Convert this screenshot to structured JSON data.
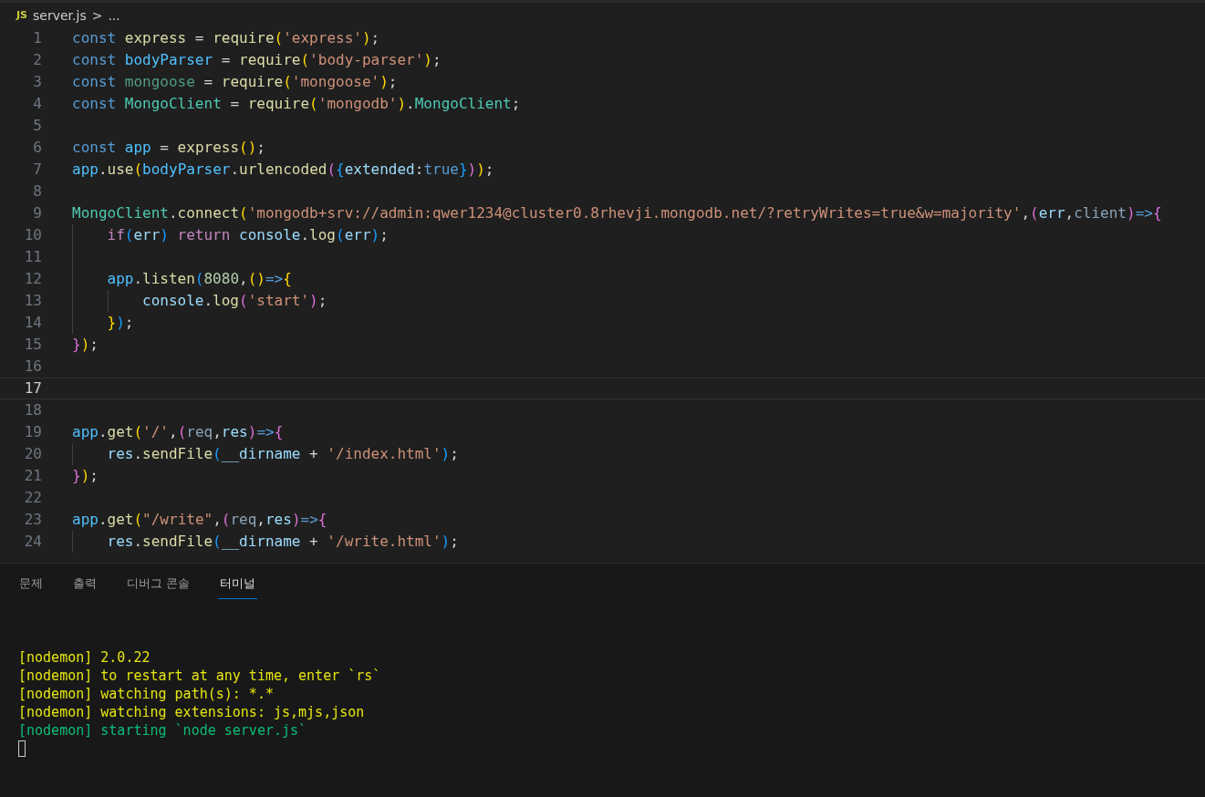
{
  "breadcrumb": {
    "file_badge": "JS",
    "file": "server.js",
    "separator": ">",
    "more": "..."
  },
  "editor": {
    "lines": [
      {
        "number": "1",
        "current": false,
        "kind": "top",
        "tokens": [
          {
            "text": "const ",
            "kind": "keyword"
          },
          {
            "text": "express",
            "kind": "func"
          },
          {
            "text": " = ",
            "kind": "plain"
          },
          {
            "text": "require",
            "kind": "func"
          },
          {
            "text": "(",
            "kind": "brace1"
          },
          {
            "text": "'express'",
            "kind": "string"
          },
          {
            "text": ")",
            "kind": "brace1"
          },
          {
            "text": ";",
            "kind": "plain"
          }
        ]
      },
      {
        "number": "2",
        "current": false,
        "kind": "top",
        "tokens": [
          {
            "text": "const ",
            "kind": "keyword"
          },
          {
            "text": "bodyParser",
            "kind": "constant"
          },
          {
            "text": " = ",
            "kind": "plain"
          },
          {
            "text": "require",
            "kind": "func"
          },
          {
            "text": "(",
            "kind": "brace1"
          },
          {
            "text": "'body-parser'",
            "kind": "string"
          },
          {
            "text": ")",
            "kind": "brace1"
          },
          {
            "text": ";",
            "kind": "plain"
          }
        ]
      },
      {
        "number": "3",
        "current": false,
        "kind": "top",
        "tokens": [
          {
            "text": "const ",
            "kind": "keyword"
          },
          {
            "text": "mongoose",
            "kind": "unused"
          },
          {
            "text": " = ",
            "kind": "plain"
          },
          {
            "text": "require",
            "kind": "func"
          },
          {
            "text": "(",
            "kind": "brace1"
          },
          {
            "text": "'mongoose'",
            "kind": "string"
          },
          {
            "text": ")",
            "kind": "brace1"
          },
          {
            "text": ";",
            "kind": "plain"
          }
        ]
      },
      {
        "number": "4",
        "current": false,
        "kind": "top",
        "tokens": [
          {
            "text": "const ",
            "kind": "keyword"
          },
          {
            "text": "MongoClient",
            "kind": "class"
          },
          {
            "text": " = ",
            "kind": "plain"
          },
          {
            "text": "require",
            "kind": "func"
          },
          {
            "text": "(",
            "kind": "brace1"
          },
          {
            "text": "'mongodb'",
            "kind": "string"
          },
          {
            "text": ")",
            "kind": "brace1"
          },
          {
            "text": ".",
            "kind": "plain"
          },
          {
            "text": "MongoClient",
            "kind": "class"
          },
          {
            "text": ";",
            "kind": "plain"
          }
        ]
      },
      {
        "number": "5",
        "current": false,
        "kind": "top"
      },
      {
        "number": "6",
        "current": false,
        "kind": "top",
        "tokens": [
          {
            "text": "const ",
            "kind": "keyword"
          },
          {
            "text": "app",
            "kind": "constant"
          },
          {
            "text": " = ",
            "kind": "plain"
          },
          {
            "text": "express",
            "kind": "func"
          },
          {
            "text": "()",
            "kind": "brace1"
          },
          {
            "text": ";",
            "kind": "plain"
          }
        ]
      },
      {
        "number": "7",
        "current": false,
        "kind": "top",
        "tokens": [
          {
            "text": "app",
            "kind": "constant"
          },
          {
            "text": ".",
            "kind": "plain"
          },
          {
            "text": "use",
            "kind": "func"
          },
          {
            "text": "(",
            "kind": "brace1"
          },
          {
            "text": "bodyParser",
            "kind": "constant"
          },
          {
            "text": ".",
            "kind": "plain"
          },
          {
            "text": "urlencoded",
            "kind": "func"
          },
          {
            "text": "(",
            "kind": "brace2"
          },
          {
            "text": "{",
            "kind": "brace3"
          },
          {
            "text": "extended",
            "kind": "variable"
          },
          {
            "text": ":",
            "kind": "plain"
          },
          {
            "text": "true",
            "kind": "keyword"
          },
          {
            "text": "}",
            "kind": "brace3"
          },
          {
            "text": ")",
            "kind": "brace2"
          },
          {
            "text": ")",
            "kind": "brace1"
          },
          {
            "text": ";",
            "kind": "plain"
          }
        ]
      },
      {
        "number": "8",
        "current": false,
        "kind": "top"
      },
      {
        "number": "9",
        "current": false,
        "kind": "top",
        "tokens": [
          {
            "text": "MongoClient",
            "kind": "class"
          },
          {
            "text": ".",
            "kind": "plain"
          },
          {
            "text": "connect",
            "kind": "func"
          },
          {
            "text": "(",
            "kind": "brace1"
          },
          {
            "text": "'mongodb+srv://admin:qwer1234@cluster0.8rhevji.mongodb.net/?retryWrites=true&w=majority'",
            "kind": "string"
          },
          {
            "text": ",",
            "kind": "plain"
          },
          {
            "text": "(",
            "kind": "brace2"
          },
          {
            "text": "err",
            "kind": "variable"
          },
          {
            "text": ",",
            "kind": "plain"
          },
          {
            "text": "client",
            "kind": "dim"
          },
          {
            "text": ")",
            "kind": "brace2"
          },
          {
            "text": "=>",
            "kind": "keyword"
          },
          {
            "text": "{",
            "kind": "brace2"
          }
        ]
      },
      {
        "number": "10",
        "current": false,
        "kind": "nested",
        "tokens": [
          {
            "text": "if",
            "kind": "control"
          },
          {
            "text": "(",
            "kind": "brace3"
          },
          {
            "text": "err",
            "kind": "variable"
          },
          {
            "text": ") ",
            "kind": "brace3"
          },
          {
            "text": "return ",
            "kind": "control"
          },
          {
            "text": "console",
            "kind": "variable"
          },
          {
            "text": ".",
            "kind": "plain"
          },
          {
            "text": "log",
            "kind": "func"
          },
          {
            "text": "(",
            "kind": "brace3"
          },
          {
            "text": "err",
            "kind": "variable"
          },
          {
            "text": ")",
            "kind": "brace3"
          },
          {
            "text": ";",
            "kind": "plain"
          }
        ]
      },
      {
        "number": "11",
        "current": false,
        "kind": "nested"
      },
      {
        "number": "12",
        "current": false,
        "kind": "nested",
        "tokens": [
          {
            "text": "app",
            "kind": "constant"
          },
          {
            "text": ".",
            "kind": "plain"
          },
          {
            "text": "listen",
            "kind": "func"
          },
          {
            "text": "(",
            "kind": "brace3"
          },
          {
            "text": "8080",
            "kind": "number"
          },
          {
            "text": ",",
            "kind": "plain"
          },
          {
            "text": "()",
            "kind": "brace1"
          },
          {
            "text": "=>",
            "kind": "keyword"
          },
          {
            "text": "{",
            "kind": "brace1"
          }
        ]
      },
      {
        "number": "13",
        "current": false,
        "kind": "deep",
        "tokens": [
          {
            "text": "console",
            "kind": "variable"
          },
          {
            "text": ".",
            "kind": "plain"
          },
          {
            "text": "log",
            "kind": "func"
          },
          {
            "text": "(",
            "kind": "brace2"
          },
          {
            "text": "'start'",
            "kind": "string"
          },
          {
            "text": ")",
            "kind": "brace2"
          },
          {
            "text": ";",
            "kind": "plain"
          }
        ]
      },
      {
        "number": "14",
        "current": false,
        "kind": "nested",
        "tokens": [
          {
            "text": "}",
            "kind": "brace1"
          },
          {
            "text": ")",
            "kind": "brace3"
          },
          {
            "text": ";",
            "kind": "plain"
          }
        ]
      },
      {
        "number": "15",
        "current": false,
        "kind": "top",
        "tokens": [
          {
            "text": "}",
            "kind": "brace2"
          },
          {
            "text": ")",
            "kind": "brace1"
          },
          {
            "text": ";",
            "kind": "plain"
          }
        ]
      },
      {
        "number": "16",
        "current": false,
        "kind": "top"
      },
      {
        "number": "17",
        "current": true,
        "kind": "top"
      },
      {
        "number": "18",
        "current": false,
        "kind": "top"
      },
      {
        "number": "19",
        "current": false,
        "kind": "top",
        "tokens": [
          {
            "text": "app",
            "kind": "constant"
          },
          {
            "text": ".",
            "kind": "plain"
          },
          {
            "text": "get",
            "kind": "func"
          },
          {
            "text": "(",
            "kind": "brace1"
          },
          {
            "text": "'/'",
            "kind": "string"
          },
          {
            "text": ",",
            "kind": "plain"
          },
          {
            "text": "(",
            "kind": "brace2"
          },
          {
            "text": "req",
            "kind": "dim"
          },
          {
            "text": ",",
            "kind": "plain"
          },
          {
            "text": "res",
            "kind": "variable"
          },
          {
            "text": ")",
            "kind": "brace2"
          },
          {
            "text": "=>",
            "kind": "keyword"
          },
          {
            "text": "{",
            "kind": "brace2"
          }
        ]
      },
      {
        "number": "20",
        "current": false,
        "kind": "nested",
        "tokens": [
          {
            "text": "res",
            "kind": "variable"
          },
          {
            "text": ".",
            "kind": "plain"
          },
          {
            "text": "sendFile",
            "kind": "func"
          },
          {
            "text": "(",
            "kind": "brace3"
          },
          {
            "text": "__dirname",
            "kind": "variable"
          },
          {
            "text": " + ",
            "kind": "plain"
          },
          {
            "text": "'/index.html'",
            "kind": "string"
          },
          {
            "text": ")",
            "kind": "brace3"
          },
          {
            "text": ";",
            "kind": "plain"
          }
        ]
      },
      {
        "number": "21",
        "current": false,
        "kind": "top",
        "tokens": [
          {
            "text": "}",
            "kind": "brace2"
          },
          {
            "text": ")",
            "kind": "brace1"
          },
          {
            "text": ";",
            "kind": "plain"
          }
        ]
      },
      {
        "number": "22",
        "current": false,
        "kind": "top"
      },
      {
        "number": "23",
        "current": false,
        "kind": "top",
        "tokens": [
          {
            "text": "app",
            "kind": "constant"
          },
          {
            "text": ".",
            "kind": "plain"
          },
          {
            "text": "get",
            "kind": "func"
          },
          {
            "text": "(",
            "kind": "brace1"
          },
          {
            "text": "\"/write\"",
            "kind": "string"
          },
          {
            "text": ",",
            "kind": "plain"
          },
          {
            "text": "(",
            "kind": "brace2"
          },
          {
            "text": "req",
            "kind": "dim"
          },
          {
            "text": ",",
            "kind": "plain"
          },
          {
            "text": "res",
            "kind": "variable"
          },
          {
            "text": ")",
            "kind": "brace2"
          },
          {
            "text": "=>",
            "kind": "keyword"
          },
          {
            "text": "{",
            "kind": "brace2"
          }
        ]
      },
      {
        "number": "24",
        "current": false,
        "kind": "nested",
        "tokens": [
          {
            "text": "res",
            "kind": "variable"
          },
          {
            "text": ".",
            "kind": "plain"
          },
          {
            "text": "sendFile",
            "kind": "func"
          },
          {
            "text": "(",
            "kind": "brace3"
          },
          {
            "text": "__dirname",
            "kind": "variable"
          },
          {
            "text": " + ",
            "kind": "plain"
          },
          {
            "text": "'/write.html'",
            "kind": "string"
          },
          {
            "text": ")",
            "kind": "brace3"
          },
          {
            "text": ";",
            "kind": "plain"
          }
        ]
      }
    ]
  },
  "panel": {
    "tabs": [
      {
        "label": "문제",
        "selected": false
      },
      {
        "label": "출력",
        "selected": false
      },
      {
        "label": "디버그 콘솔",
        "selected": false
      },
      {
        "label": "터미널",
        "selected": true
      }
    ],
    "terminal": {
      "lines": [
        {
          "text": "[nodemon] 2.0.22",
          "kind": "info"
        },
        {
          "text": "[nodemon] to restart at any time, enter `rs`",
          "kind": "info"
        },
        {
          "text": "[nodemon] watching path(s): *.*",
          "kind": "info"
        },
        {
          "text": "[nodemon] watching extensions: js,mjs,json",
          "kind": "info"
        },
        {
          "text": "[nodemon] starting `node server.js`",
          "kind": "success"
        }
      ]
    }
  }
}
